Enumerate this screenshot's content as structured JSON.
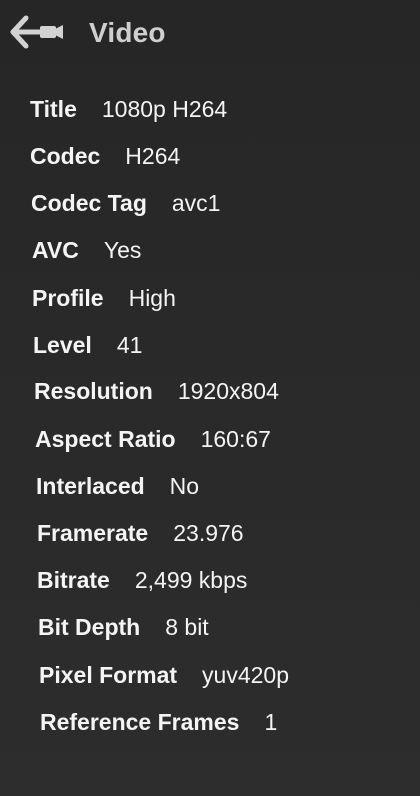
{
  "header": {
    "title": "Video",
    "back_icon": "back-arrow-camera-icon"
  },
  "details": [
    {
      "label": "Title",
      "value": "1080p H264"
    },
    {
      "label": "Codec",
      "value": "H264"
    },
    {
      "label": "Codec Tag",
      "value": "avc1"
    },
    {
      "label": "AVC",
      "value": "Yes"
    },
    {
      "label": "Profile",
      "value": "High"
    },
    {
      "label": "Level",
      "value": "41"
    },
    {
      "label": "Resolution",
      "value": "1920x804"
    },
    {
      "label": "Aspect Ratio",
      "value": "160:67"
    },
    {
      "label": "Interlaced",
      "value": "No"
    },
    {
      "label": "Framerate",
      "value": "23.976"
    },
    {
      "label": "Bitrate",
      "value": "2,499 kbps"
    },
    {
      "label": "Bit Depth",
      "value": "8 bit"
    },
    {
      "label": "Pixel Format",
      "value": "yuv420p"
    },
    {
      "label": "Reference Frames",
      "value": "1"
    }
  ]
}
